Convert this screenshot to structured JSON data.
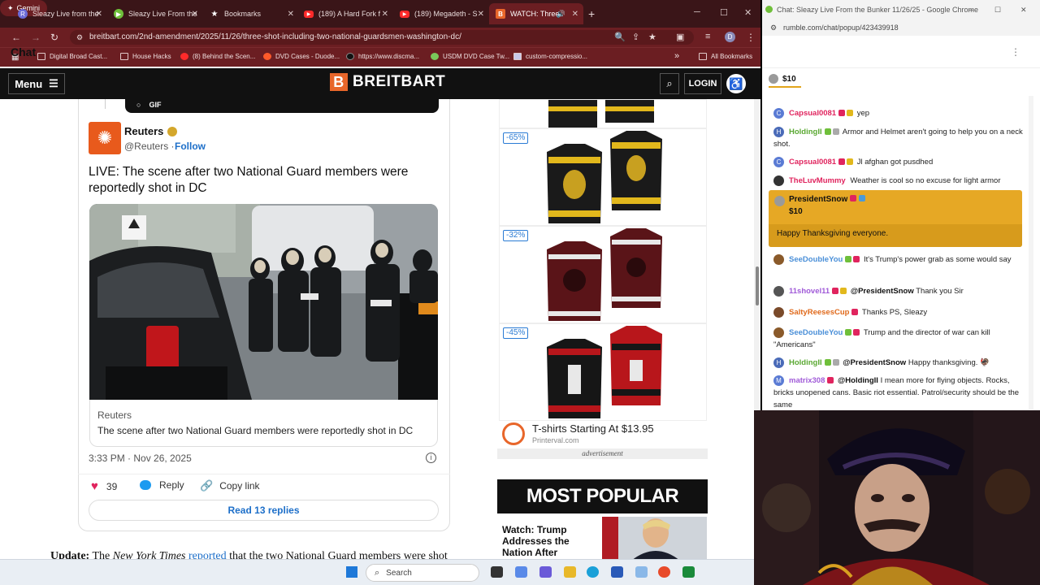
{
  "browser": {
    "tabs": [
      {
        "label": "Sleazy Live from the",
        "icon_color": "#6b6bd8"
      },
      {
        "label": "Sleazy Live From the",
        "icon_color": "#6fbf3a"
      },
      {
        "label": "Bookmarks",
        "icon_color": "#ffffff"
      },
      {
        "label": "(189) A Hard Fork f",
        "icon_color": "#ff2a2a"
      },
      {
        "label": "(189) Megadeth - S",
        "icon_color": "#ff2a2a"
      },
      {
        "label": "WATCH: Three S",
        "icon_color": "#e8662a"
      }
    ],
    "new_tab": "+",
    "gemini": "Gemini",
    "url": "breitbart.com/2nd-amendment/2025/11/26/three-shot-including-two-national-guardsmen-washington-dc/",
    "bookmarks": [
      "Digital Broad Cast...",
      "House Hacks",
      "(8) Behind the Scen...",
      "DVD Cases - Duode...",
      "https://www.discma...",
      "USDM DVD Case Tw...",
      "custom-compressio..."
    ],
    "all_bookmarks": "All Bookmarks",
    "more": "»"
  },
  "site": {
    "menu": "Menu",
    "logo": "BREITBART",
    "logo_letter": "B",
    "login": "LOGIN"
  },
  "tweet": {
    "gif": "GIF",
    "author": "Reuters",
    "handle": "@Reuters ·",
    "follow": "Follow",
    "text": "LIVE: The scene after two National Guard members were reportedly shot in DC",
    "card_source": "Reuters",
    "card_title": "The scene after two National Guard members were reportedly shot in DC",
    "timestamp": "3:33 PM · Nov 26, 2025",
    "likes": "39",
    "reply": "Reply",
    "copy_link": "Copy link",
    "read_replies": "Read 13 replies"
  },
  "article": {
    "update_label": "Update:",
    "update_the": "The",
    "update_source": "New York Times",
    "update_link": "reported",
    "update_rest": "that the two National Guard members were shot"
  },
  "ads": {
    "discounts": [
      "-65%",
      "-32%",
      "-45%"
    ],
    "title": "T-shirts Starting At $13.95",
    "sub": "Printerval.com",
    "label": "advertisement"
  },
  "most_popular": {
    "heading": "MOST POPULAR",
    "item": "Watch: Trump Addresses the Nation After"
  },
  "taskbar": {
    "search": "Search"
  },
  "chat": {
    "window_title": "Chat: Sleazy Live From the Bunker 11/26/25 - Google Chrome",
    "url": "rumble.com/chat/popup/423439918",
    "heading": "Chat",
    "pinned_amount": "$10",
    "messages": [
      {
        "user": "Capsual0081",
        "text": "yep",
        "color": "#e0245e",
        "av": "C",
        "av_color": "#5a7bd4"
      },
      {
        "user": "HoldingII",
        "text": "Armor and Helmet aren't going to help you on a neck shot.",
        "color": "#5aa832",
        "av": "H",
        "av_color": "#4a6bb8"
      },
      {
        "user": "Capsual0081",
        "text": "Jl afghan got pusdhed",
        "color": "#e0245e",
        "av": "C",
        "av_color": "#5a7bd4"
      },
      {
        "user": "TheLuvMummy",
        "text": "Weather is cool so no excuse for light armor",
        "color": "#e0245e",
        "av": "",
        "av_color": "#333333"
      },
      {
        "user": "SeeDoubleYou",
        "text": "It's Trump's power grab as some would say",
        "color": "#4a8fd8",
        "av": "",
        "av_color": "#8a5a2a"
      },
      {
        "user": "11shovel11",
        "mention": "@PresidentSnow",
        "text": "Thank you Sir",
        "color": "#a05ad8",
        "av": "",
        "av_color": "#555555"
      },
      {
        "user": "SaltyReesesCup",
        "text": "Thanks PS, Sleazy",
        "color": "#e06a1c",
        "av": "",
        "av_color": "#7a4a2a"
      },
      {
        "user": "SeeDoubleYou",
        "text": "Trump and the director of war can kill \"Americans\"",
        "color": "#4a8fd8",
        "av": "",
        "av_color": "#8a5a2a"
      },
      {
        "user": "HoldingII",
        "mention": "@PresidentSnow",
        "text": "Happy thanksgiving.",
        "color": "#5aa832",
        "av": "H",
        "av_color": "#4a6bb8"
      },
      {
        "user": "matrix308",
        "mention": "@HoldingII",
        "text": "I mean more for flying objects. Rocks, bricks unopened cans. Basic riot essential. Patrol/security should be the same",
        "color": "#a05ad8",
        "av": "M",
        "av_color": "#5a7bd4"
      }
    ],
    "rant": {
      "user": "PresidentSnow",
      "amount": "$10",
      "text": "Happy Thanksgiving everyone."
    }
  },
  "colors": {
    "tab_bg": "#3a1518",
    "toolbar": "#6b1e22",
    "rant": "#e6a825",
    "link": "#1d6fc9"
  }
}
